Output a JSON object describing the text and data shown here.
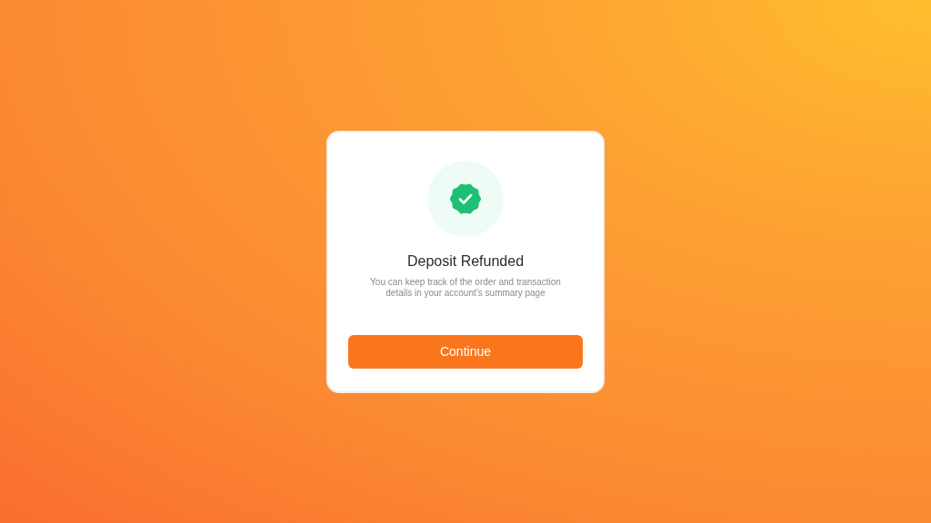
{
  "dialog": {
    "title": "Deposit Refunded",
    "message": "You can keep track of the order and transaction details in your account’s summary page",
    "button": "Continue"
  }
}
